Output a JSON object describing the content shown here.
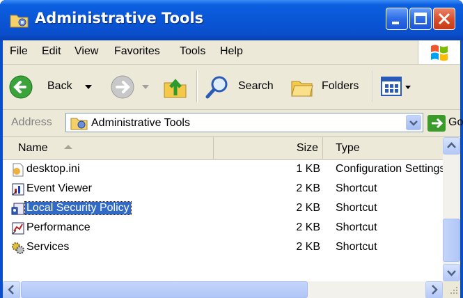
{
  "window": {
    "title": "Administrative Tools"
  },
  "menu": [
    "File",
    "Edit",
    "View",
    "Favorites",
    "Tools",
    "Help"
  ],
  "toolbar": {
    "back_label": "Back",
    "search_label": "Search",
    "folders_label": "Folders"
  },
  "address": {
    "label": "Address",
    "value": "Administrative Tools",
    "go_label": "Go"
  },
  "columns": {
    "name": "Name",
    "size": "Size",
    "type": "Type"
  },
  "files": [
    {
      "name": "desktop.ini",
      "size": "1 KB",
      "type": "Configuration Settings",
      "icon": "ini-file-icon"
    },
    {
      "name": "Event Viewer",
      "size": "2 KB",
      "type": "Shortcut",
      "icon": "event-viewer-icon"
    },
    {
      "name": "Local Security Policy",
      "size": "2 KB",
      "type": "Shortcut",
      "icon": "security-policy-icon",
      "selected": true
    },
    {
      "name": "Performance",
      "size": "2 KB",
      "type": "Shortcut",
      "icon": "performance-icon"
    },
    {
      "name": "Services",
      "size": "2 KB",
      "type": "Shortcut",
      "icon": "services-icon"
    }
  ],
  "colors": {
    "titlebar": "#0a56d6",
    "selection": "#316ac5",
    "face": "#ece9d8"
  }
}
